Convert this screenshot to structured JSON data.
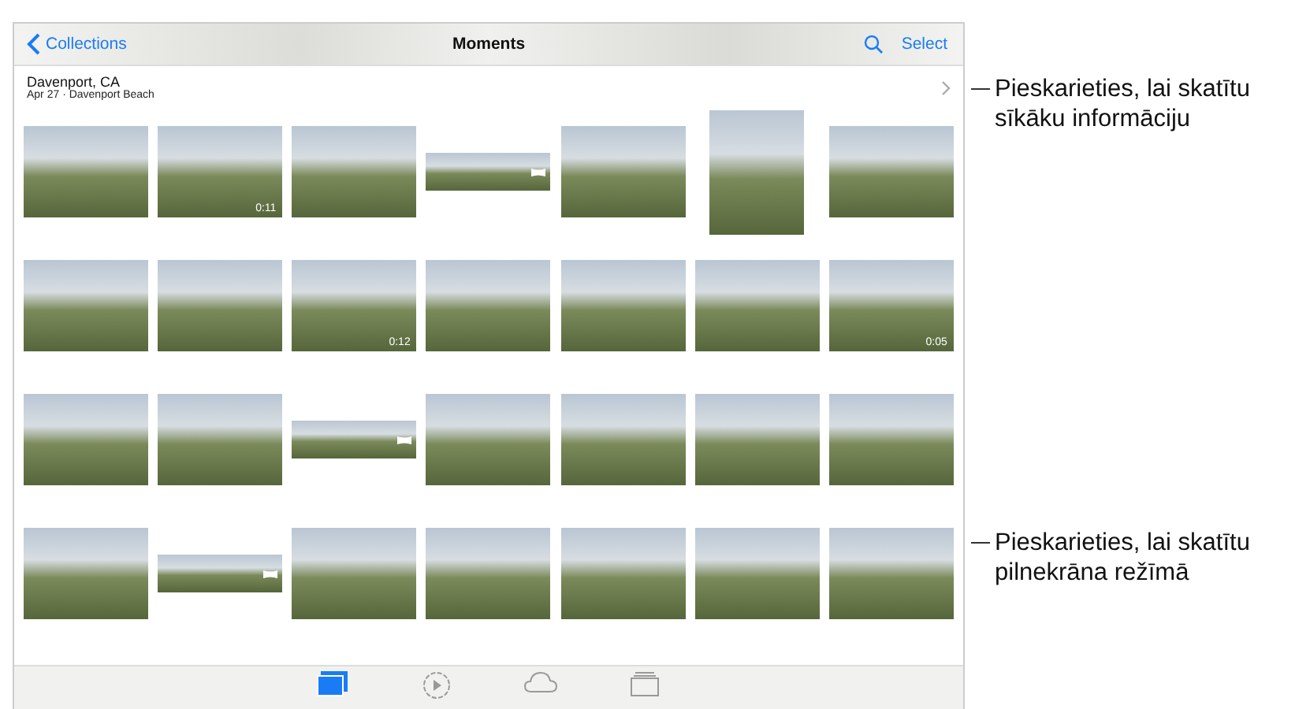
{
  "nav_bar": {
    "back": "Collections",
    "title": "Moments",
    "select": "Select"
  },
  "moment_header": {
    "place": "Davenport, CA",
    "subtitle": "Apr 27 · Davenport Beach"
  },
  "photo_rows": [
    [
      {
        "kind": "landscape"
      },
      {
        "kind": "landscape",
        "duration": "0:11"
      },
      {
        "kind": "landscape"
      },
      {
        "kind": "panorama"
      },
      {
        "kind": "landscape"
      },
      {
        "kind": "portrait"
      },
      {
        "kind": "landscape"
      }
    ],
    [
      {
        "kind": "landscape"
      },
      {
        "kind": "landscape"
      },
      {
        "kind": "landscape",
        "duration": "0:12"
      },
      {
        "kind": "landscape"
      },
      {
        "kind": "landscape"
      },
      {
        "kind": "landscape"
      },
      {
        "kind": "landscape",
        "duration": "0:05"
      }
    ],
    [
      {
        "kind": "landscape"
      },
      {
        "kind": "landscape"
      },
      {
        "kind": "panorama"
      },
      {
        "kind": "landscape"
      },
      {
        "kind": "landscape"
      },
      {
        "kind": "landscape"
      },
      {
        "kind": "landscape"
      }
    ],
    [
      {
        "kind": "landscape"
      },
      {
        "kind": "panorama"
      },
      {
        "kind": "landscape"
      },
      {
        "kind": "landscape"
      },
      {
        "kind": "landscape"
      },
      {
        "kind": "landscape"
      },
      {
        "kind": "landscape"
      }
    ]
  ],
  "tab_bar": [
    {
      "kind": "photos",
      "selected": true
    },
    {
      "kind": "memories",
      "selected": false
    },
    {
      "kind": "shared",
      "selected": false
    },
    {
      "kind": "albums",
      "selected": false
    }
  ],
  "callouts": [
    "Pieskarieties, lai skatītu sīkāku informāciju",
    "Pieskarieties, lai skatītu pilnekrāna režīmā"
  ]
}
